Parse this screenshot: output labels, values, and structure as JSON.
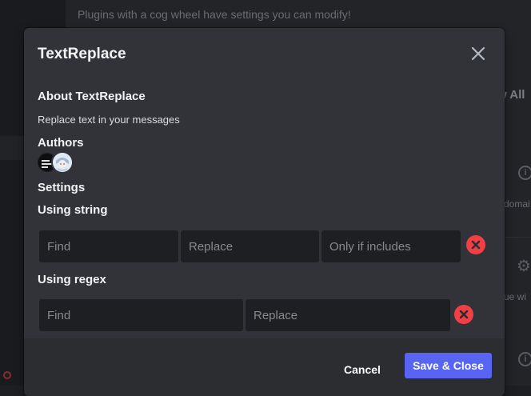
{
  "background": {
    "hint_text": "Plugins with a cog wheel have settings you can modify!",
    "button_fragment": "w All",
    "text_fragment_1": "domai",
    "text_fragment_2": "ue wi"
  },
  "modal": {
    "title": "TextReplace",
    "close_icon": "close-icon",
    "about": {
      "heading": "About TextReplace",
      "description": "Replace text in your messages"
    },
    "authors": {
      "heading": "Authors",
      "avatars": [
        "author-avatar-1",
        "author-avatar-2"
      ]
    },
    "settings": {
      "heading": "Settings",
      "string_rules": {
        "heading": "Using string",
        "find_placeholder": "Find",
        "replace_placeholder": "Replace",
        "only_if_includes_placeholder": "Only if includes",
        "find_value": "",
        "replace_value": "",
        "only_if_includes_value": ""
      },
      "regex_rules": {
        "heading": "Using regex",
        "find_placeholder": "Find",
        "replace_placeholder": "Replace",
        "find_value": "",
        "replace_value": ""
      }
    },
    "footer": {
      "cancel_label": "Cancel",
      "save_label": "Save & Close"
    }
  },
  "colors": {
    "accent": "#5865f2",
    "danger": "#f23f43",
    "modal_bg": "#313338",
    "footer_bg": "#2b2d31",
    "input_bg": "#1e1f22"
  }
}
